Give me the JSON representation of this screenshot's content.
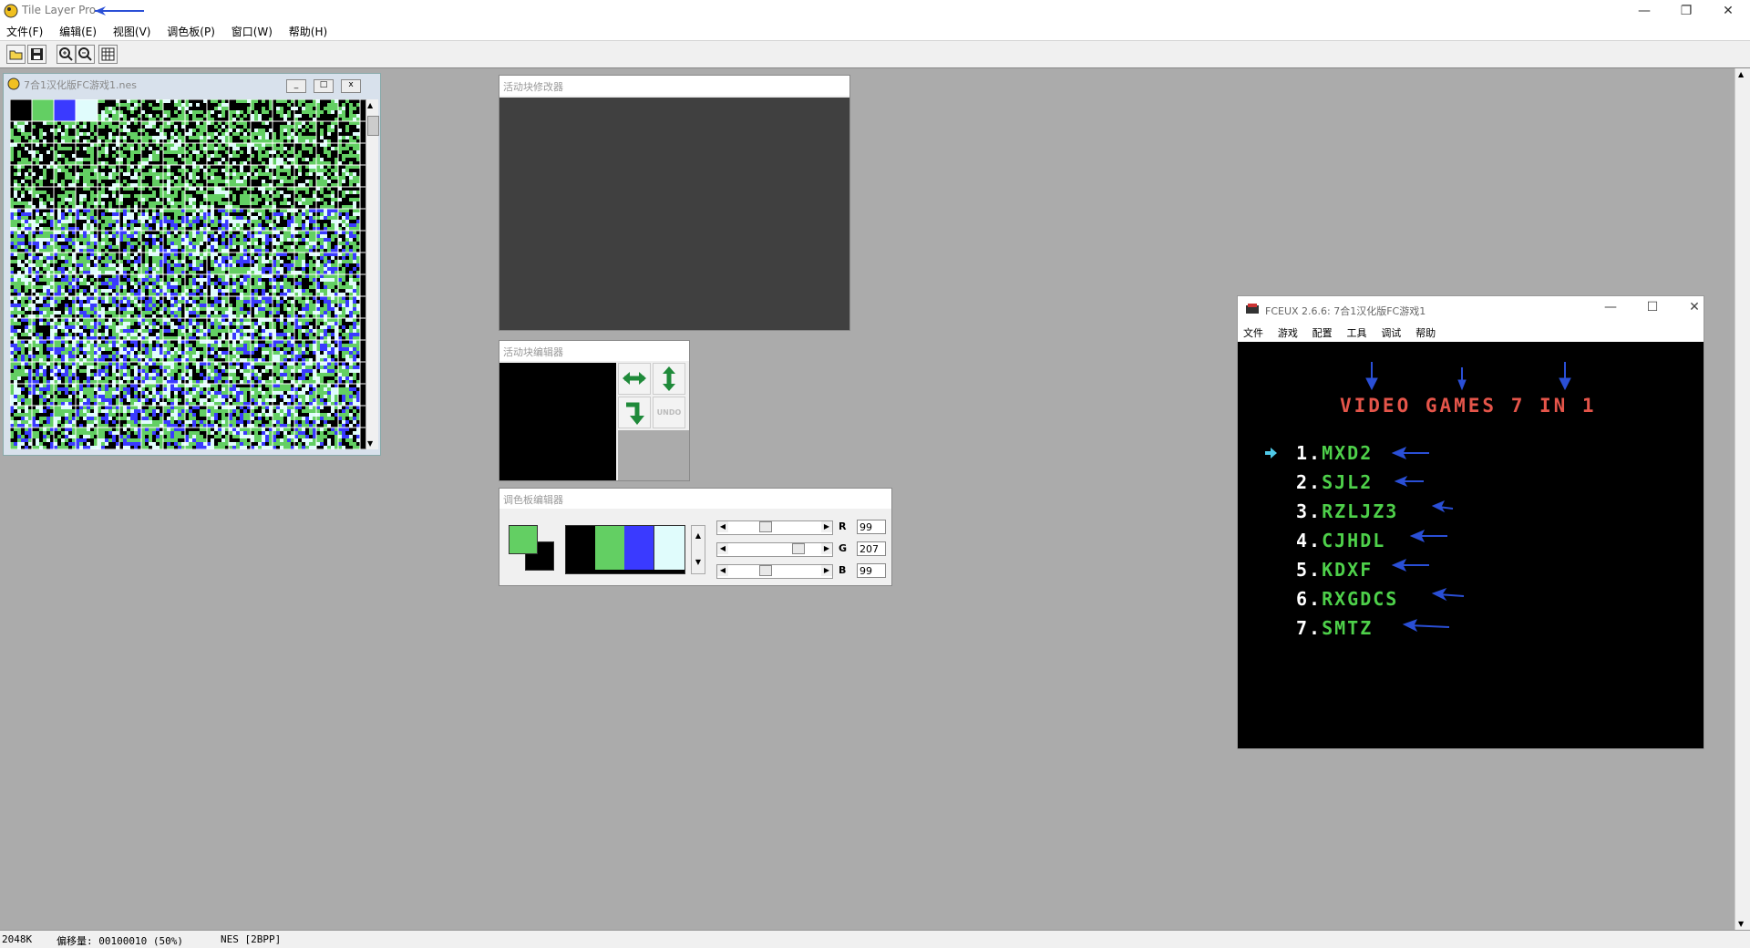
{
  "app": {
    "title": "Tile Layer Pro",
    "window_controls": {
      "minimize": "—",
      "restore": "❐",
      "close": "✕"
    }
  },
  "menu": [
    "文件(F)",
    "编辑(E)",
    "视图(V)",
    "调色板(P)",
    "窗口(W)",
    "帮助(H)"
  ],
  "toolbar": {
    "icons": [
      "open-icon",
      "save-icon",
      "zoom-in-icon",
      "zoom-out-icon",
      "grid-icon"
    ]
  },
  "tile_window": {
    "title": "7合1汉化版FC游戏1.nes",
    "palette_preview": [
      "#000000",
      "#63cf63",
      "#3a3aff",
      "#e0fcfc"
    ]
  },
  "modifier_window": {
    "title": "活动块修改器"
  },
  "editor_window": {
    "title": "活动块编辑器",
    "undo_label": "UNDO",
    "buttons": [
      "flip-horizontal-icon",
      "flip-vertical-icon",
      "rotate-icon"
    ]
  },
  "palette_window": {
    "title": "调色板编辑器",
    "selected_fg": "#63cf63",
    "selected_bg": "#000000",
    "swatches": [
      "#000000",
      "#63cf63",
      "#3a3aff",
      "#e0fcfc"
    ],
    "channels": [
      {
        "label": "R",
        "value": "99",
        "level": 0.39
      },
      {
        "label": "G",
        "value": "207",
        "level": 0.81
      },
      {
        "label": "B",
        "value": "99",
        "level": 0.39
      }
    ]
  },
  "fceux": {
    "title": "FCEUX 2.6.6: 7合1汉化版FC游戏1",
    "menu": [
      "文件",
      "游戏",
      "配置",
      "工具",
      "调试",
      "帮助"
    ],
    "screen_title": "VIDEO GAMES 7 IN 1",
    "items": [
      {
        "num": "1.",
        "name": "MXD2"
      },
      {
        "num": "2.",
        "name": "SJL2"
      },
      {
        "num": "3.",
        "name": "RZLJZ3"
      },
      {
        "num": "4.",
        "name": "CJHDL"
      },
      {
        "num": "5.",
        "name": "KDXF"
      },
      {
        "num": "6.",
        "name": "RXGDCS"
      },
      {
        "num": "7.",
        "name": "SMTZ"
      }
    ]
  },
  "status": {
    "size": "2048K",
    "offset": "偏移量: 00100010 (50%)",
    "format": "NES [2BPP]"
  }
}
